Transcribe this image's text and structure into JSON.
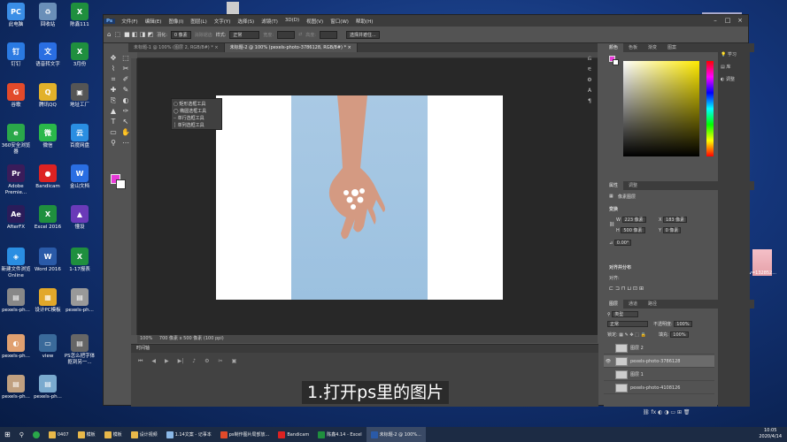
{
  "desktop": {
    "icons": [
      {
        "label": "此电脑",
        "color": "#3a8ee6",
        "glyph": "PC"
      },
      {
        "label": "回收站",
        "color": "#6a8fb8",
        "glyph": "♻"
      },
      {
        "label": "陈鑫111",
        "color": "#1f8f3e",
        "glyph": "X"
      },
      {
        "label": "钉钉",
        "color": "#2a7ae2",
        "glyph": "钉"
      },
      {
        "label": "语音转文字",
        "color": "#2a6ee2",
        "glyph": "文"
      },
      {
        "label": "3月份",
        "color": "#1f8f3e",
        "glyph": "X"
      },
      {
        "label": "谷歌",
        "color": "#e24a2a",
        "glyph": "G"
      },
      {
        "label": "腾讯QQ",
        "color": "#e2b12a",
        "glyph": "Q"
      },
      {
        "label": "地址工厂",
        "color": "#555",
        "glyph": "▣"
      },
      {
        "label": "360安全浏览器",
        "color": "#2aa84a",
        "glyph": "e"
      },
      {
        "label": "微信",
        "color": "#2ab84a",
        "glyph": "微"
      },
      {
        "label": "百度网盘",
        "color": "#2a8ee2",
        "glyph": "云"
      },
      {
        "label": "Adobe Premie...",
        "color": "#3a1c5a",
        "glyph": "Pr"
      },
      {
        "label": "Bandicam",
        "color": "#d22",
        "glyph": "●"
      },
      {
        "label": "金山文档",
        "color": "#2a6ee2",
        "glyph": "W"
      },
      {
        "label": "AfterFX",
        "color": "#2a1c5a",
        "glyph": "Ae"
      },
      {
        "label": "Excel 2016",
        "color": "#1f8f3e",
        "glyph": "X"
      },
      {
        "label": "懂设",
        "color": "#6a3ab8",
        "glyph": "▲"
      },
      {
        "label": "新建文件浏览Online",
        "color": "#2a8ee2",
        "glyph": "◈"
      },
      {
        "label": "Word 2016",
        "color": "#2a5aa8",
        "glyph": "W"
      },
      {
        "label": "1-17报表",
        "color": "#1f8f3e",
        "glyph": "X"
      },
      {
        "label": "pexels-ph...",
        "color": "#888",
        "glyph": "▤"
      },
      {
        "label": "设计PC模板",
        "color": "#e2a82a",
        "glyph": "▦"
      },
      {
        "label": "pexels-ph...",
        "color": "#999",
        "glyph": "▤"
      },
      {
        "label": "pexels-ph...",
        "color": "#e0a070",
        "glyph": "◐"
      },
      {
        "label": "view",
        "color": "#3a6a9a",
        "glyph": "▭"
      },
      {
        "label": "PS怎么把字体抠到另一...",
        "color": "#666",
        "glyph": "▤"
      },
      {
        "label": "pexels-ph...",
        "color": "#c0a080",
        "glyph": "▤"
      },
      {
        "label": "pexels-ph...",
        "color": "#7aaace",
        "glyph": "▤"
      }
    ],
    "right_icon_label": "v=132852..."
  },
  "ps": {
    "logo": "Ps",
    "menus": [
      "文件(F)",
      "编辑(E)",
      "图像(I)",
      "图层(L)",
      "文字(Y)",
      "选择(S)",
      "滤镜(T)",
      "3D(D)",
      "视图(V)",
      "窗口(W)",
      "帮助(H)"
    ],
    "options": {
      "feather_label": "羽化:",
      "feather_value": "0 像素",
      "antialias": "消除锯齿",
      "style_label": "样式:",
      "style_value": "正常",
      "width_label": "宽度:",
      "height_label": "高度:",
      "select_mask": "选择并遮住..."
    },
    "tabs": [
      {
        "label": "未标题-1 @ 100% (图层 2, RGB/8#) *",
        "active": false
      },
      {
        "label": "未标题-2 @ 100% (pexels-photo-3786128, RGB/8#) *",
        "active": true
      }
    ],
    "tool_flyout": [
      "矩形选框工具",
      "椭圆选框工具",
      "单行选框工具",
      "单列选框工具"
    ],
    "status": {
      "zoom": "100%",
      "size": "700 像素 x 500 像素 (100 ppi)"
    },
    "timeline": {
      "title": "时间轴"
    },
    "caption": "1.打开ps里的图片",
    "panels": {
      "color_tabs": [
        "颜色",
        "色板",
        "渐变",
        "图案"
      ],
      "props_tabs": [
        "属性",
        "调整"
      ],
      "props_title": "像素图层",
      "transform": {
        "title": "变换",
        "w_label": "W",
        "w": "223 像素",
        "x_label": "X",
        "x": "183 像素",
        "h_label": "H",
        "h": "500 像素",
        "y_label": "Y",
        "y": "0 像素",
        "angle": "0.00°"
      },
      "align": {
        "title": "对齐并分布",
        "sub": "对齐:"
      },
      "layers_tabs": [
        "图层",
        "通道",
        "路径"
      ],
      "layer_kind": "类型",
      "blend": "正常",
      "opacity_label": "不透明度:",
      "opacity": "100%",
      "lock_label": "锁定:",
      "fill_label": "填充:",
      "fill": "100%",
      "layers": [
        {
          "name": "图层 2",
          "selected": false
        },
        {
          "name": "pexels-photo-3786128",
          "selected": true
        },
        {
          "name": "图层 1",
          "selected": false
        },
        {
          "name": "pexels-photo-4108126",
          "selected": false
        }
      ],
      "collapsed": [
        "学习",
        "库",
        "调整"
      ]
    }
  },
  "taskbar": {
    "items": [
      {
        "label": "0407",
        "color": "#e8b84a"
      },
      {
        "label": "模板",
        "color": "#e8b84a"
      },
      {
        "label": "模板",
        "color": "#e8b84a"
      },
      {
        "label": "设计视频",
        "color": "#e8b84a"
      },
      {
        "label": "1.14文案 - 记事本",
        "color": "#8ab8e8"
      },
      {
        "label": "ps制作图片局部放...",
        "color": "#e24a2a"
      },
      {
        "label": "Bandicam",
        "color": "#d22"
      },
      {
        "label": "陈鑫4.14 - Excel",
        "color": "#1f8f3e"
      },
      {
        "label": "未标题-2 @ 100%...",
        "color": "#2a5aa8"
      }
    ],
    "time": "10:05",
    "date": "2020/4/14"
  }
}
